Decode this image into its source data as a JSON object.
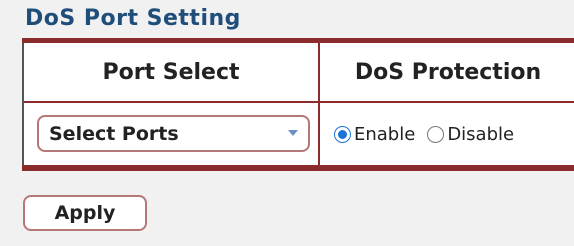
{
  "section": {
    "title": "DoS Port Setting"
  },
  "table": {
    "headers": {
      "port_select": "Port Select",
      "dos_protection": "DoS Protection"
    },
    "port_select": {
      "value": "Select Ports"
    },
    "dos_protection": {
      "options": [
        {
          "label": "Enable",
          "selected": true
        },
        {
          "label": "Disable",
          "selected": false
        }
      ]
    }
  },
  "actions": {
    "apply_label": "Apply"
  },
  "colors": {
    "accent": "#8b2b2b",
    "title": "#1f4e7a",
    "radio": "#1a73d9"
  }
}
